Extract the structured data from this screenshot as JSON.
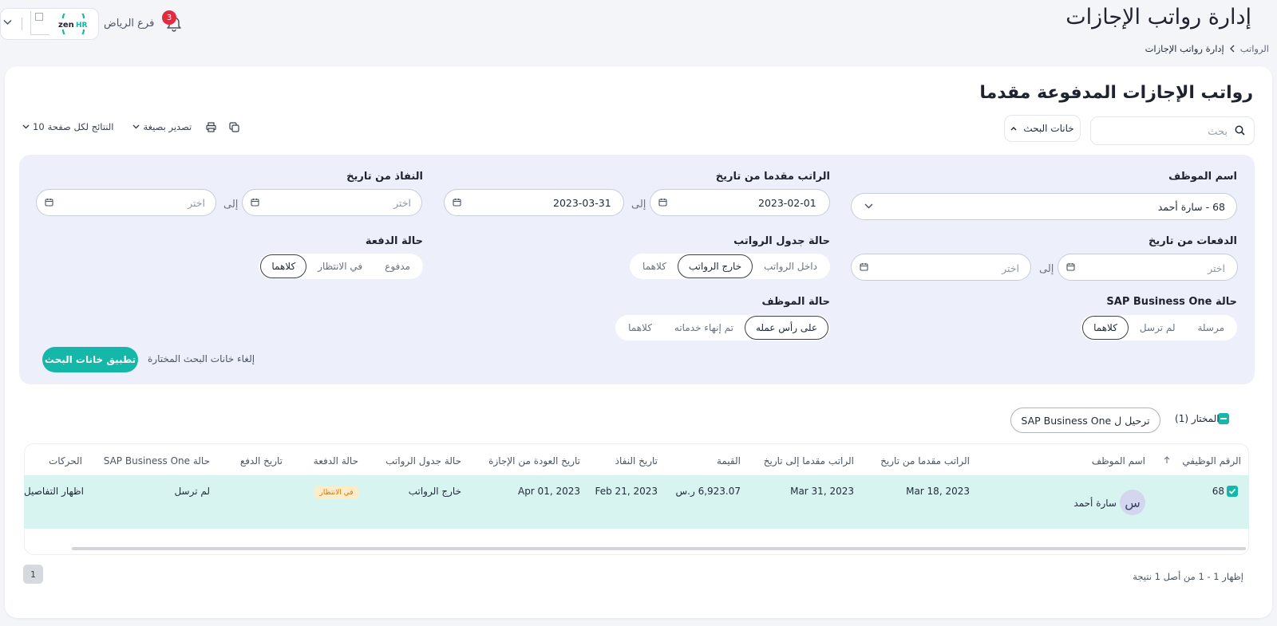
{
  "header": {
    "page_title": "إدارة رواتب الإجازات",
    "breadcrumb": [
      "الرواتب",
      "إدارة رواتب الإجازات"
    ],
    "notifications_count": "3",
    "branch_name": "فرع الرياض",
    "logo_text": "zenHR"
  },
  "section": {
    "title": "رواتب الإجازات المدفوعة مقدما",
    "search_placeholder": "بحث",
    "filters_button": "خانات البحث",
    "per_page_label": "النتائج لكل صفحة",
    "per_page_value": "10",
    "export_label": "تصدير بصيغة"
  },
  "filters": {
    "employee_name": {
      "label": "اسم الموظف",
      "value": "68 - سارة أحمد"
    },
    "advance_date": {
      "label": "الراتب مقدما من تاريخ",
      "from": "2023-02-01",
      "to": "2023-03-31",
      "to_label": "إلى"
    },
    "effective_date": {
      "label": "النفاذ من تاريخ",
      "from_placeholder": "اختر",
      "to_placeholder": "اختر",
      "to_label": "إلى"
    },
    "payments_date": {
      "label": "الدفعات من تاريخ",
      "from_placeholder": "اختر",
      "to_placeholder": "اختر",
      "to_label": "إلى"
    },
    "payroll_status": {
      "label": "حالة جدول الرواتب",
      "options": [
        "داخل الرواتب",
        "خارج الرواتب",
        "كلاهما"
      ],
      "active_index": 1
    },
    "payment_status": {
      "label": "حالة الدفعة",
      "options": [
        "مدفوع",
        "في الانتظار",
        "كلاهما"
      ],
      "active_index": 2
    },
    "sap_status": {
      "label": "حالة SAP Business One",
      "options": [
        "مرسلة",
        "لم ترسل",
        "كلاهما"
      ],
      "active_index": 2
    },
    "employee_status": {
      "label": "حالة الموظف",
      "options": [
        "على رأس عمله",
        "تم إنهاء خدماته",
        "كلاهما"
      ],
      "active_index": 0
    },
    "apply_button": "تطبيق خانات البحث",
    "clear_link": "إلغاء خانات البحث المختارة"
  },
  "bulk": {
    "selected_label": "المختار (1)",
    "post_button": "ترحيل ل SAP Business One"
  },
  "table": {
    "columns": [
      "الرقم الوظيفي",
      "اسم الموظف",
      "الراتب مقدما من تاريخ",
      "الراتب مقدما إلى تاريخ",
      "القيمة",
      "تاريخ النفاذ",
      "تاريخ العودة من الإجازة",
      "حالة جدول الرواتب",
      "حالة الدفعة",
      "تاريخ الدفع",
      "حالة SAP Business One",
      "الحركات"
    ],
    "rows": [
      {
        "employee_id": "68",
        "avatar_initial": "س",
        "employee_name": "سارة أحمد",
        "advance_from": "Mar 18, 2023",
        "advance_to": "Mar 31, 2023",
        "amount": "6,923.07 ر.س",
        "effective_date": "Feb 21, 2023",
        "return_date": "Apr 01, 2023",
        "payroll_status": "خارج الرواتب",
        "payment_status": "في الانتظار",
        "payment_date": "",
        "sap_status": "لم ترسل",
        "action": "اظهار التفاصيل"
      }
    ]
  },
  "pagination": {
    "current_page": "1",
    "result_info": "إظهار 1 - 1 من أصل 1 نتيجة"
  },
  "colors": {
    "accent": "#15b7a8",
    "panel_bg": "#edf0fb",
    "row_highlight": "#d8f4f1",
    "badge_red": "#e5293f",
    "pending_bg": "#fdecc8",
    "pending_text": "#d97706"
  },
  "icons": [
    "bell-icon",
    "chevron-down-icon",
    "search-icon",
    "chevron-up-icon",
    "copy-icon",
    "print-icon",
    "calendar-icon",
    "sort-arrow-icon",
    "check-icon"
  ]
}
